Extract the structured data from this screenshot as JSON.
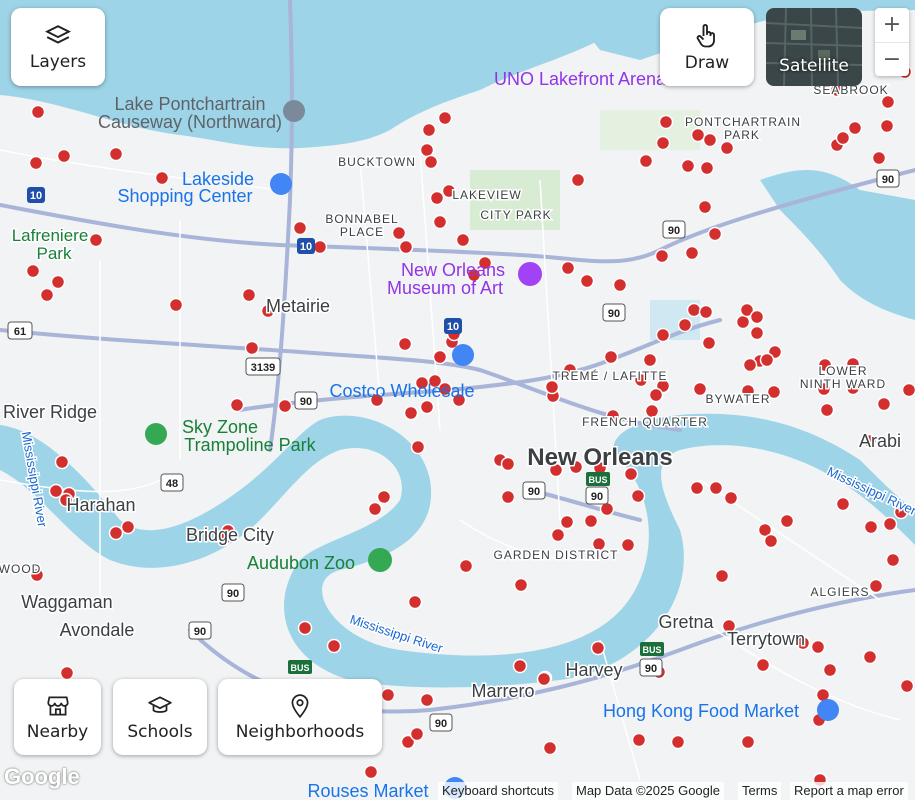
{
  "controls": {
    "layers_label": "Layers",
    "draw_label": "Draw",
    "satellite_label": "Satellite",
    "zoom_in": "+",
    "zoom_out": "−",
    "nearby_label": "Nearby",
    "schools_label": "Schools",
    "neighborhoods_label": "Neighborhoods"
  },
  "footer": {
    "logo": "Google",
    "keyboard": "Keyboard shortcuts",
    "map_data": "Map Data ©2025 Google",
    "terms": "Terms",
    "report": "Report a map error"
  },
  "map": {
    "pois": {
      "uno": "UNO Lakefront Arena",
      "causeway_1": "Lake Pontchartrain",
      "causeway_2": "Causeway (Northward)",
      "lakeside_1": "Lakeside",
      "lakeside_2": "Shopping Center",
      "museum_1": "New Orleans",
      "museum_2": "Museum of Art",
      "costco": "Costco Wholesale",
      "skyzone_1": "Sky Zone",
      "skyzone_2": "Trampoline Park",
      "audubon": "Audubon Zoo",
      "hongkong": "Hong Kong Food Market",
      "rouses": "Rouses Market"
    },
    "places": {
      "bucktown": "BUCKTOWN",
      "lakeview": "LAKEVIEW",
      "city_park": "CITY PARK",
      "bonnabel_1": "BONNABEL",
      "bonnabel_2": "PLACE",
      "lafreniere_1": "Lafreniere",
      "lafreniere_2": "Park",
      "metairie": "Metairie",
      "river_ridge": "River Ridge",
      "harahan": "Harahan",
      "bridge_city": "Bridge City",
      "waggaman": "Waggaman",
      "avondale": "Avondale",
      "marrero": "Marrero",
      "harvey": "Harvey",
      "gretna": "Gretna",
      "terrytown": "Terrytown",
      "algiers": "ALGIERS",
      "new_orleans": "New Orleans",
      "garden_district": "GARDEN DISTRICT",
      "french_quarter": "FRENCH QUARTER",
      "treme": "TREMÉ / LAFITTE",
      "bywater": "BYWATER",
      "lower_1": "LOWER",
      "lower_2": "NINTH WARD",
      "pontchartrain_1": "PONTCHARTRAIN",
      "pontchartrain_2": "PARK",
      "seabrook": "SEABROOK",
      "chalmette": "Arabi",
      "wood": "WOOD",
      "river_1": "Mississippi River",
      "river_2": "Mississippi River",
      "river_3": "Mississippi River"
    },
    "shields": {
      "i10_a": "10",
      "i10_b": "10",
      "i10_c": "10",
      "us90_a": "90",
      "us90_b": "90",
      "us90_c": "90",
      "us90_d": "90",
      "us90_e": "90",
      "us90_f": "90",
      "us90_g": "90",
      "us90_h": "90",
      "us90_i": "90",
      "us90_j": "90",
      "r61": "61",
      "r3139": "3139",
      "r48": "48",
      "bus_a": "BUS",
      "bus_b": "BUS",
      "bus_c": "BUS"
    },
    "pin_color": "#d32f2f",
    "water_color": "#9ed4e8",
    "land_color": "#f1f3f4"
  }
}
